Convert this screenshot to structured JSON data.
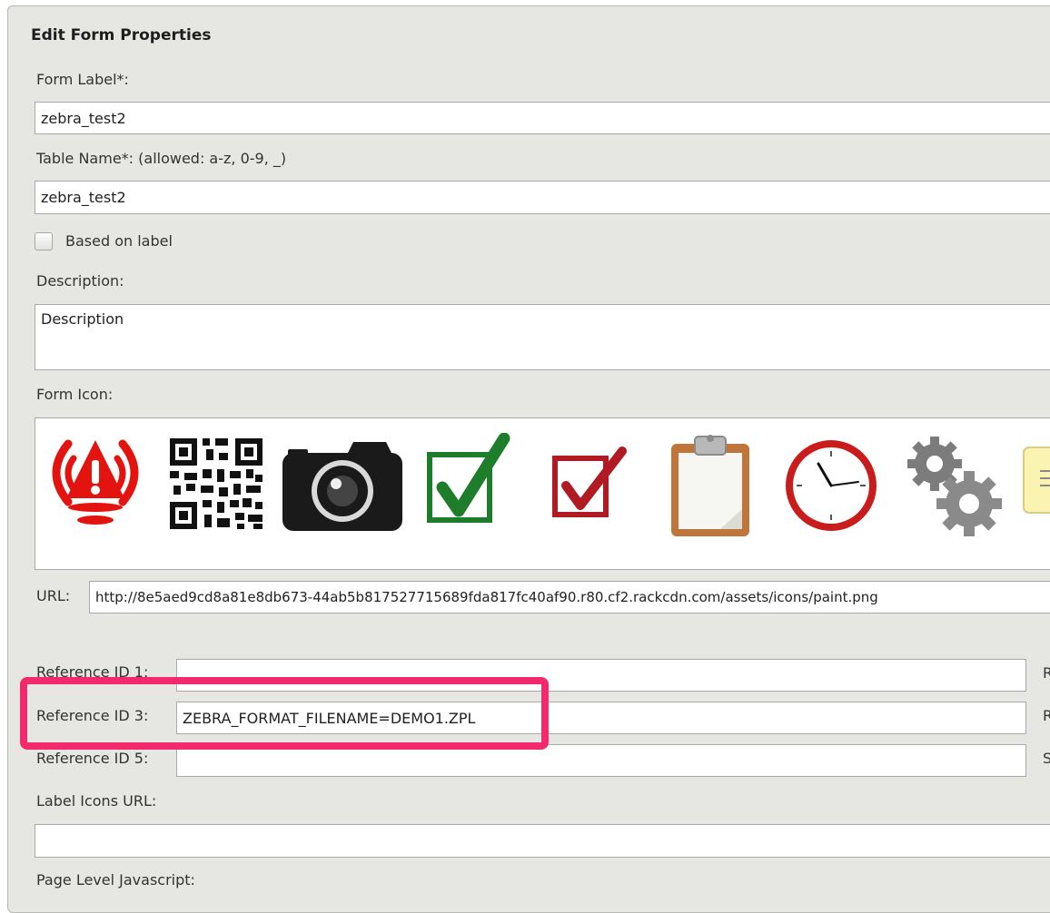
{
  "panel": {
    "title": "Edit Form Properties"
  },
  "form": {
    "form_label": {
      "label": "Form Label*:",
      "value": "zebra_test2"
    },
    "table_name": {
      "label": "Table Name*: (allowed: a-z, 0-9, _)",
      "value": "zebra_test2"
    },
    "based_on_label": {
      "label": "Based on label",
      "checked": false
    },
    "description": {
      "label": "Description:",
      "value": "Description"
    },
    "form_icon": {
      "label": "Form Icon:",
      "icons": [
        "alarm-icon",
        "qr-code-icon",
        "camera-icon",
        "green-checkbox-icon",
        "red-checkbox-icon",
        "clipboard-icon",
        "clock-icon",
        "gears-icon",
        "notepad-icon"
      ]
    },
    "url": {
      "label": "URL:",
      "value": "http://8e5aed9cd8a81e8db673-44ab5b817527715689fda817fc40af90.r80.cf2.rackcdn.com/assets/icons/paint.png"
    },
    "reference_id_1": {
      "label": "Reference ID 1:",
      "value": "",
      "right_label_cut": "R"
    },
    "reference_id_3": {
      "label": "Reference ID 3:",
      "value": "ZEBRA_FORMAT_FILENAME=DEMO1.ZPL",
      "right_label_cut": "R"
    },
    "reference_id_5": {
      "label": "Reference ID 5:",
      "value": "",
      "right_label_cut": "S"
    },
    "label_icons_url": {
      "label": "Label Icons URL:",
      "value": ""
    },
    "page_level_js": {
      "label": "Page Level Javascript:"
    }
  },
  "colors": {
    "highlight": "#f22a6d",
    "panel_bg": "#e6e7e3"
  }
}
